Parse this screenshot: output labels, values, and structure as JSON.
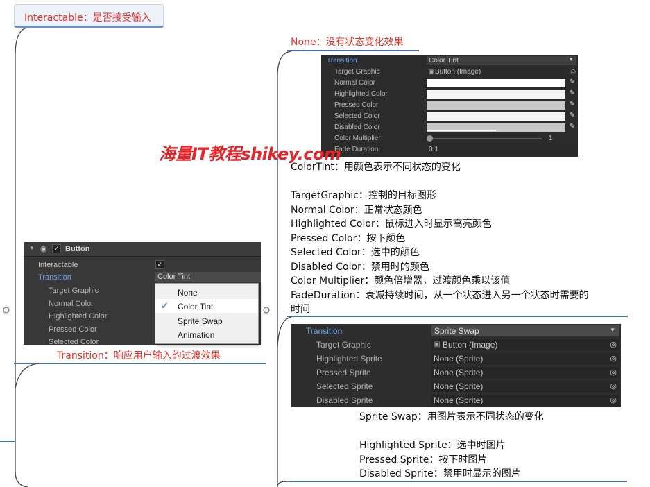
{
  "interactable_note": "Interactable：是否接受输入",
  "none_note": "None：没有状态变化效果",
  "transition_note": "Transition：响应用户输入的过渡效果",
  "watermark": "海量IT教程shikey.com",
  "color_tint_panel": {
    "transition_label": "Transition",
    "transition_value": "Color Tint",
    "rows": [
      {
        "label": "Target Graphic",
        "value": "Button (Image)"
      },
      {
        "label": "Normal Color"
      },
      {
        "label": "Highlighted Color"
      },
      {
        "label": "Pressed Color"
      },
      {
        "label": "Selected Color"
      },
      {
        "label": "Disabled Color"
      },
      {
        "label": "Color Multiplier",
        "value": "1"
      },
      {
        "label": "Fade Duration",
        "value": "0.1"
      }
    ],
    "swatch_colors": [
      "#ffffff",
      "#f5f5f5",
      "#c8c8c8",
      "#f5f5f5",
      "#c8c8c8"
    ]
  },
  "color_tint_desc": [
    "ColorTint：用颜色表示不同状态的变化",
    "",
    "TargetGraphic：控制的目标图形",
    "Normal Color：正常状态颜色",
    "Highlighted Color：鼠标进入时显示高亮颜色",
    "Pressed Color：按下颜色",
    "Selected Color：选中的颜色",
    "Disabled Color：禁用时的颜色",
    "Color Multiplier：颜色倍增器，过渡颜色乘以该值",
    "FadeDuration：衰减持续时间，从一个状态进入另一个状态时需要的",
    "时间"
  ],
  "button_panel": {
    "title": "Button",
    "interactable_label": "Interactable",
    "transition_label": "Transition",
    "transition_value": "Color Tint",
    "rows": [
      "Target Graphic",
      "Normal Color",
      "Highlighted Color",
      "Pressed Color",
      "Selected Color"
    ],
    "menu_options": [
      "None",
      "Color Tint",
      "Sprite Swap",
      "Animation"
    ],
    "menu_selected": "Color Tint"
  },
  "sprite_swap_panel": {
    "transition_label": "Transition",
    "transition_value": "Sprite Swap",
    "rows": [
      {
        "label": "Target Graphic",
        "value": "Button (Image)"
      },
      {
        "label": "Highlighted Sprite",
        "value": "None (Sprite)"
      },
      {
        "label": "Pressed Sprite",
        "value": "None (Sprite)"
      },
      {
        "label": "Selected Sprite",
        "value": "None (Sprite)"
      },
      {
        "label": "Disabled Sprite",
        "value": "None (Sprite)"
      }
    ]
  },
  "sprite_swap_desc": [
    "Sprite Swap：用图片表示不同状态的变化",
    "",
    "Highlighted Sprite：选中时图片",
    "Pressed Sprite：按下时图片",
    "Disabled Sprite：禁用时显示的图片"
  ],
  "colors": {
    "accent_line": "#4a6ea8",
    "note_red": "#e0342c",
    "panel_bg": "#2b2b2b",
    "check_blue": "#3d7bd9"
  }
}
